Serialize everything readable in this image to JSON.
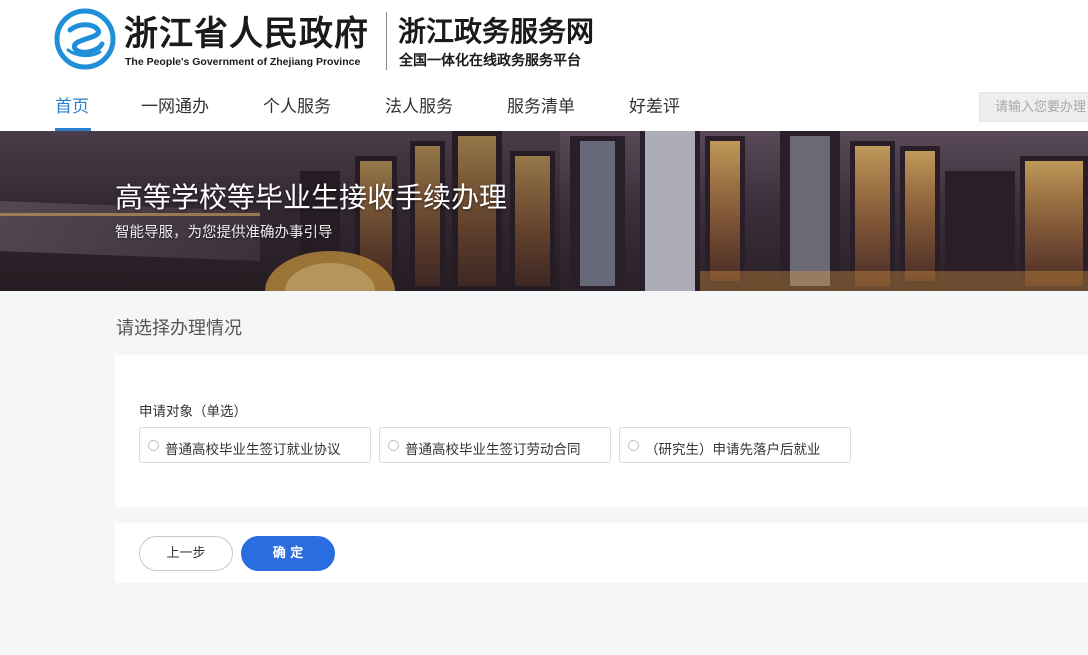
{
  "header": {
    "gov_title": "浙江省人民政府",
    "gov_subtitle": "The People's Government of Zhejiang Province",
    "site_title": "浙江政务服务网",
    "site_subtitle": "全国一体化在线政务服务平台",
    "logo_icon": "zhejiang-emblem-icon"
  },
  "nav": {
    "items": [
      {
        "label": "首页",
        "active": true
      },
      {
        "label": "一网通办",
        "active": false
      },
      {
        "label": "个人服务",
        "active": false
      },
      {
        "label": "法人服务",
        "active": false
      },
      {
        "label": "服务清单",
        "active": false
      },
      {
        "label": "好差评",
        "active": false
      }
    ],
    "accent_color": "#2d7ecf"
  },
  "search": {
    "placeholder": "请输入您要办理"
  },
  "banner": {
    "title": "高等学校等毕业生接收手续办理",
    "subtitle": "智能导服，为您提供准确办事引导"
  },
  "form": {
    "section_title": "请选择办理情况",
    "field_label": "申请对象（单选）",
    "options": [
      {
        "label": "普通高校毕业生签订就业协议",
        "selected": false
      },
      {
        "label": "普通高校毕业生签订劳动合同",
        "selected": false
      },
      {
        "label": "（研究生）申请先落户后就业",
        "selected": false
      }
    ]
  },
  "actions": {
    "prev_label": "上一步",
    "confirm_label": "确 定",
    "primary_color": "#2a6de0"
  }
}
